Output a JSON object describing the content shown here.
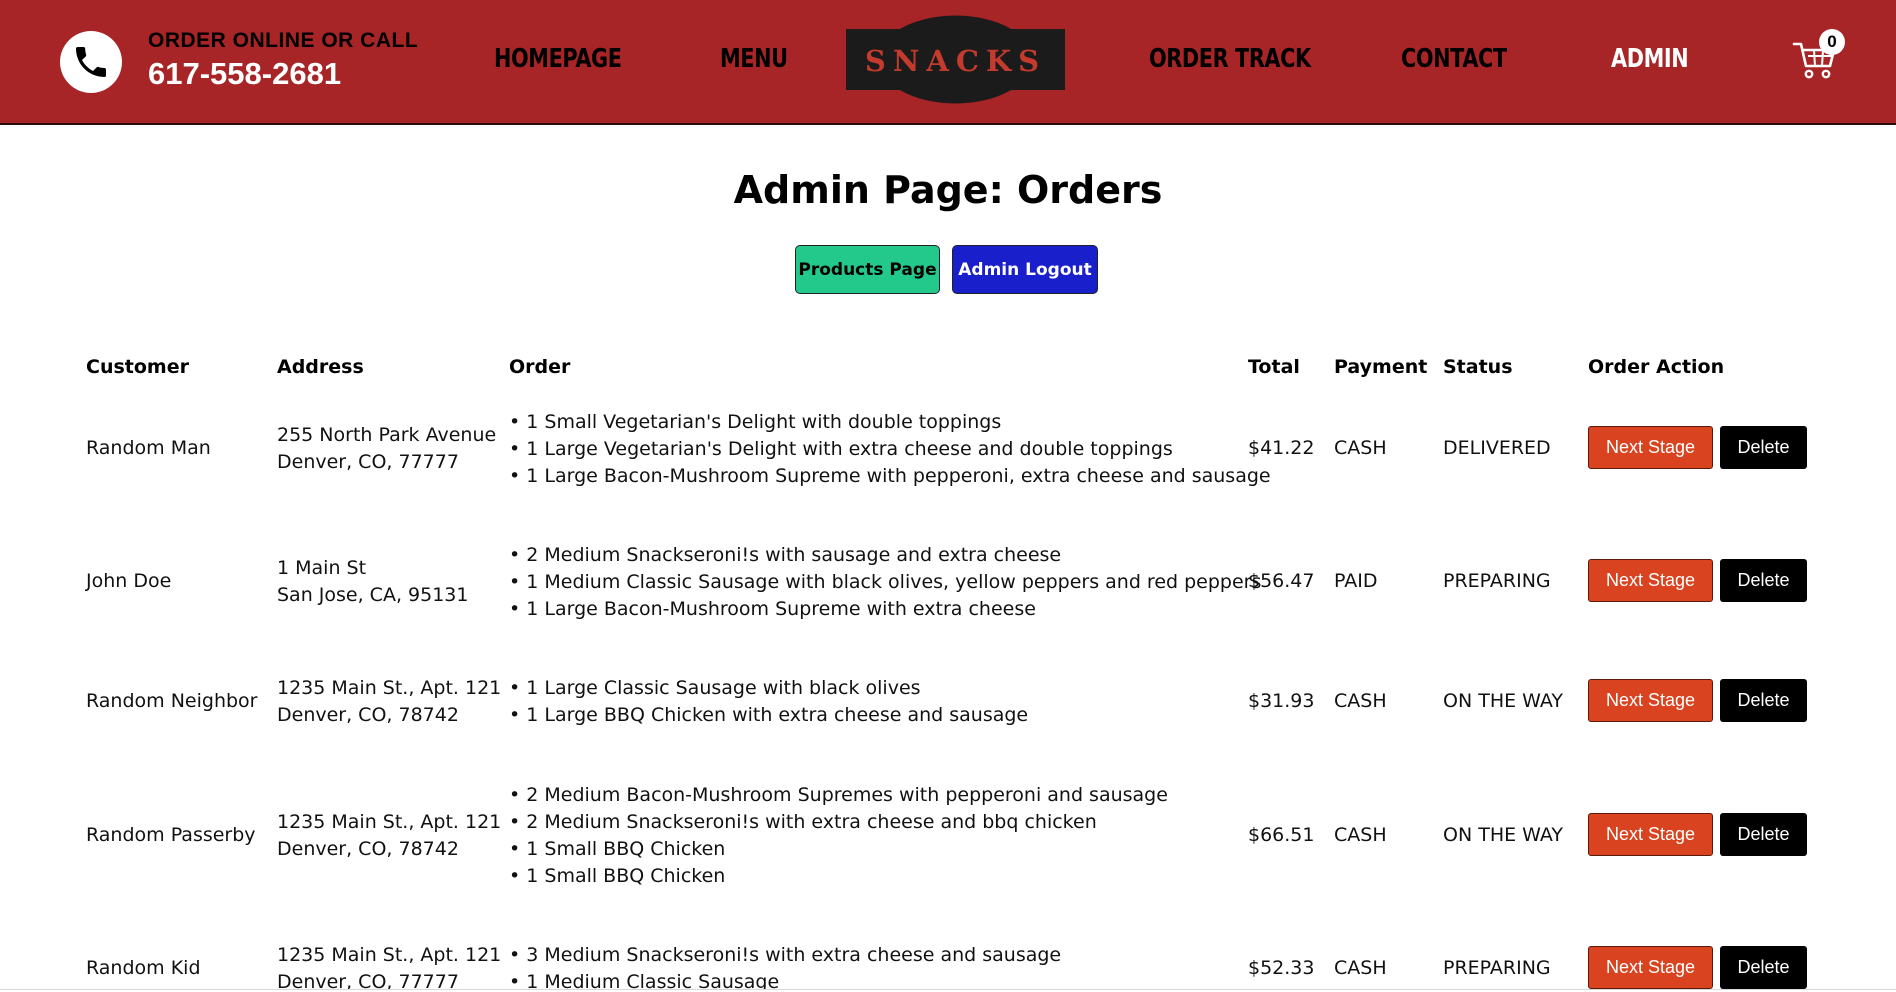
{
  "header": {
    "call_label": "ORDER ONLINE OR CALL",
    "phone_number": "617-558-2681",
    "nav": {
      "home": "HOMEPAGE",
      "menu": "MENU",
      "order_track": "ORDER TRACK",
      "contact": "CONTACT",
      "admin": "ADMIN"
    },
    "logo_text": "SNACKS",
    "cart_count": "0",
    "icons": {
      "phone": "phone-icon",
      "cart": "cart-icon",
      "logo": "snacks-logo"
    }
  },
  "page": {
    "title": "Admin Page: Orders",
    "products_button": "Products Page",
    "logout_button": "Admin Logout"
  },
  "table": {
    "headers": {
      "customer": "Customer",
      "address": "Address",
      "order": "Order",
      "total": "Total",
      "payment": "Payment",
      "status": "Status",
      "action": "Order Action"
    },
    "action_labels": {
      "next": "Next Stage",
      "delete": "Delete"
    },
    "rows": [
      {
        "customer": "Random Man",
        "address1": "255 North Park Avenue",
        "address2": "Denver, CO, 77777",
        "items": [
          "1 Small Vegetarian's Delight with double toppings",
          "1 Large Vegetarian's Delight with extra cheese and double toppings",
          "1 Large Bacon-Mushroom Supreme with pepperoni, extra cheese and sausage"
        ],
        "total": "$41.22",
        "payment": "CASH",
        "status": "DELIVERED"
      },
      {
        "customer": "John Doe",
        "address1": "1 Main St",
        "address2": "San Jose, CA, 95131",
        "items": [
          "2 Medium Snackseroni!s with sausage and extra cheese",
          "1 Medium Classic Sausage with black olives, yellow peppers and red peppers",
          "1 Large Bacon-Mushroom Supreme with extra cheese"
        ],
        "total": "$56.47",
        "payment": "PAID",
        "status": "PREPARING"
      },
      {
        "customer": "Random Neighbor",
        "address1": "1235 Main St., Apt. 121",
        "address2": "Denver, CO, 78742",
        "items": [
          "1 Large Classic Sausage with black olives",
          "1 Large BBQ Chicken with extra cheese and sausage"
        ],
        "total": "$31.93",
        "payment": "CASH",
        "status": "ON THE WAY"
      },
      {
        "customer": "Random Passerby",
        "address1": "1235 Main St., Apt. 121",
        "address2": "Denver, CO, 78742",
        "items": [
          "2 Medium Bacon-Mushroom Supremes with pepperoni and sausage",
          "2 Medium Snackseroni!s with extra cheese and bbq chicken",
          "1 Small BBQ Chicken",
          "1 Small BBQ Chicken"
        ],
        "total": "$66.51",
        "payment": "CASH",
        "status": "ON THE WAY"
      },
      {
        "customer": "Random Kid",
        "address1": "1235 Main St., Apt. 121",
        "address2": "Denver, CO, 77777",
        "items": [
          "3 Medium Snackseroni!s with extra cheese and sausage",
          "1 Medium Classic Sausage"
        ],
        "total": "$52.33",
        "payment": "CASH",
        "status": "PREPARING"
      }
    ]
  },
  "colors": {
    "header_bg": "#a72427",
    "products_button": "#22c98a",
    "logout_button": "#1a1fcc",
    "next_stage_button": "#d9431f",
    "delete_button": "#000000"
  }
}
